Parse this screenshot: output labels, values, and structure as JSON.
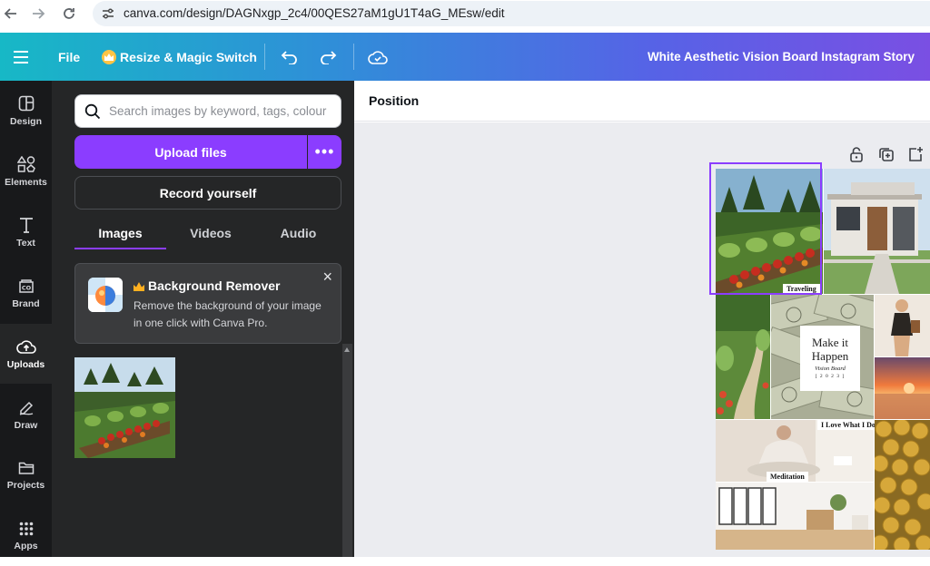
{
  "browser": {
    "url": "canva.com/design/DAGNxgp_2c4/00QES27aM1gU1T4aG_MEsw/edit",
    "icons": [
      "back-arrow-icon",
      "forward-arrow-icon",
      "reload-icon",
      "site-settings-icon"
    ]
  },
  "header": {
    "file_label": "File",
    "resize_label": "Resize & Magic Switch",
    "design_title": "White Aesthetic Vision Board Instagram Story",
    "icons": [
      "menu-icon",
      "crown-icon",
      "undo-icon",
      "redo-icon",
      "cloud-saved-icon"
    ]
  },
  "rail": {
    "items": [
      {
        "label": "Design",
        "icon": "design-icon"
      },
      {
        "label": "Elements",
        "icon": "elements-icon"
      },
      {
        "label": "Text",
        "icon": "text-icon"
      },
      {
        "label": "Brand",
        "icon": "brand-icon"
      },
      {
        "label": "Uploads",
        "icon": "uploads-icon"
      },
      {
        "label": "Draw",
        "icon": "draw-icon"
      },
      {
        "label": "Projects",
        "icon": "projects-icon"
      },
      {
        "label": "Apps",
        "icon": "apps-icon"
      }
    ],
    "active": "Uploads"
  },
  "panel": {
    "search_placeholder": "Search images by keyword, tags, colour",
    "upload_label": "Upload files",
    "more_label": "•••",
    "record_label": "Record yourself",
    "tabs": [
      "Images",
      "Videos",
      "Audio"
    ],
    "active_tab": "Images",
    "promo": {
      "title": "Background Remover",
      "description": "Remove the background of your image in one click with Canva Pro.",
      "close": "×"
    }
  },
  "position_bar": {
    "label": "Position"
  },
  "canvas": {
    "labels": {
      "traveling": "Traveling",
      "love": "I Love What I Do",
      "meditation": "Meditation"
    },
    "make_it": {
      "line1": "Make it",
      "line2": "Happen",
      "line3": "Vision Board",
      "line4": "[ 2 0 2 3 ]"
    },
    "toolbar_icons": [
      "lock-icon",
      "duplicate-icon",
      "add-page-icon"
    ]
  },
  "colors": {
    "accent": "#8b3dff",
    "rail_bg": "#18191b",
    "panel_bg": "#252627",
    "canvas_bg": "#ebecf0"
  }
}
